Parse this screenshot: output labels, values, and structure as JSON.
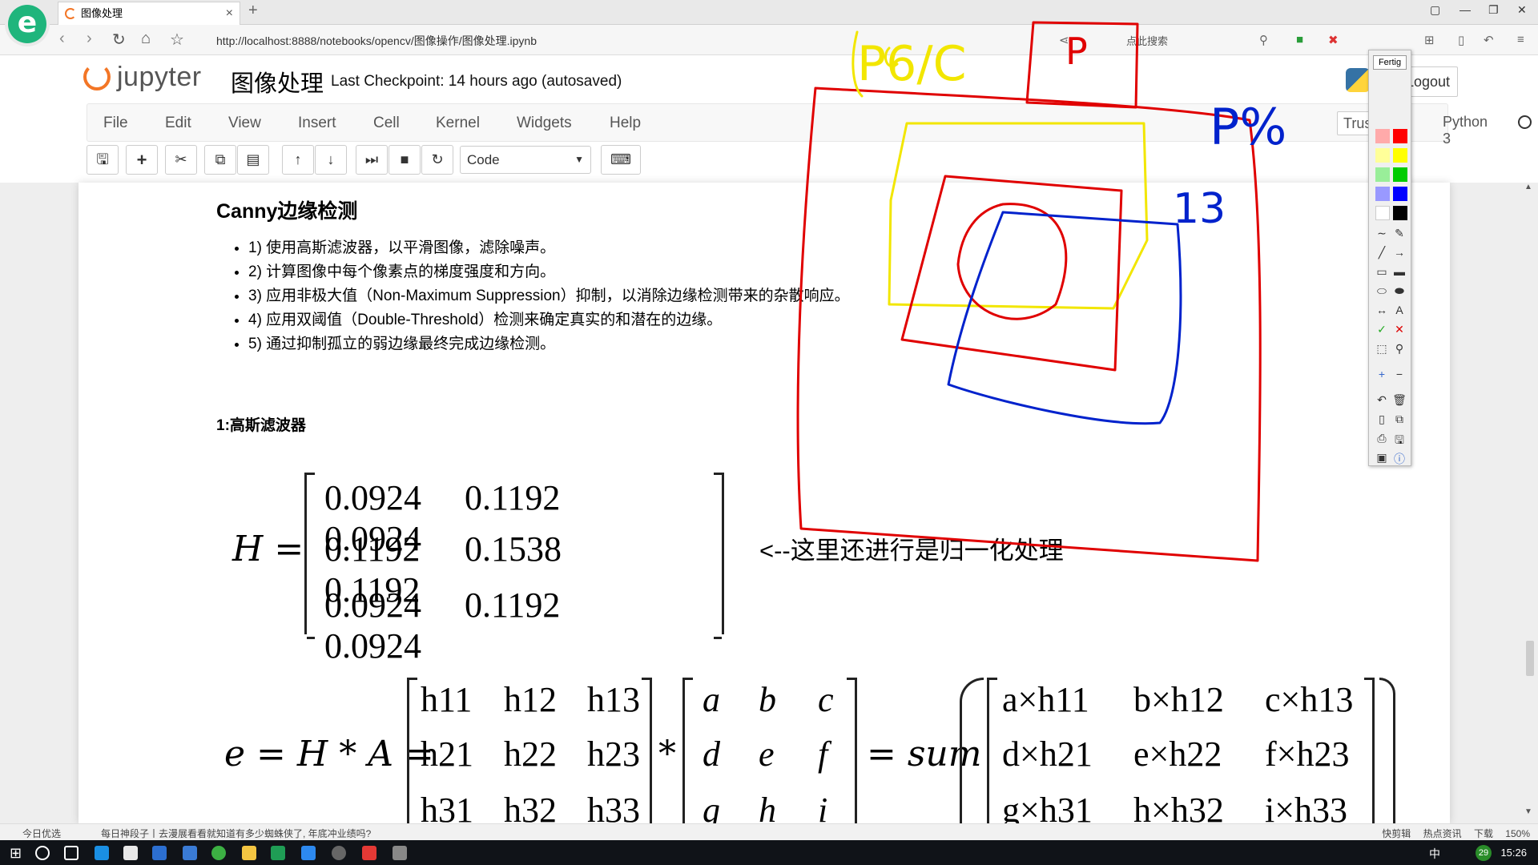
{
  "browser": {
    "tab_title": "图像处理",
    "tab_close": "×",
    "new_tab": "+",
    "url": "http://localhost:8888/notebooks/opencv/图像操作/图像处理.ipynb",
    "search_placeholder": "点此搜索",
    "win_controls": [
      "▢",
      "—",
      "❐",
      "✕"
    ]
  },
  "jupyter": {
    "logo_text": "jupyter",
    "notebook_title": "图像处理",
    "checkpoint": "Last Checkpoint: 14 hours ago (autosaved)",
    "logout": "Logout",
    "menu": [
      "File",
      "Edit",
      "View",
      "Insert",
      "Cell",
      "Kernel",
      "Widgets",
      "Help"
    ],
    "trusted": "Trusted",
    "kernel": "Python 3",
    "cell_type": "Code",
    "toolbar_icons": [
      "save-icon",
      "plus-icon",
      "cut-icon",
      "copy-icon",
      "paste-icon",
      "arrow-up-icon",
      "arrow-down-icon",
      "step-forward-icon",
      "stop-icon",
      "restart-icon",
      "keyboard-icon"
    ]
  },
  "notebook": {
    "heading": "Canny边缘检测",
    "steps": [
      "1) 使用高斯滤波器，以平滑图像，滤除噪声。",
      "2) 计算图像中每个像素点的梯度强度和方向。",
      "3) 应用非极大值（Non-Maximum Suppression）抑制，以消除边缘检测带来的杂散响应。",
      "4) 应用双阈值（Double-Threshold）检测来确定真实的和潜在的边缘。",
      "5) 通过抑制孤立的弱边缘最终完成边缘检测。"
    ],
    "subheading": "1:高斯滤波器",
    "H_label": "H =",
    "H_rows": [
      [
        "0.0924",
        "0.1192",
        "0.0924"
      ],
      [
        "0.1192",
        "0.1538",
        "0.1192"
      ],
      [
        "0.0924",
        "0.1192",
        "0.0924"
      ]
    ],
    "norm_note": "<--这里还进行是归一化处理",
    "conv_lhs": "e = H * A =",
    "star": "*",
    "sum_label": "= sum",
    "h_matrix": [
      [
        "h11",
        "h12",
        "h13"
      ],
      [
        "h21",
        "h22",
        "h23"
      ],
      [
        "h31",
        "h32",
        "h33"
      ]
    ],
    "a_matrix": [
      [
        "a",
        "b",
        "c"
      ],
      [
        "d",
        "e",
        "f"
      ],
      [
        "g",
        "h",
        "i"
      ]
    ],
    "prod_matrix": [
      [
        "a×h11",
        "b×h12",
        "c×h13"
      ],
      [
        "d×h21",
        "e×h22",
        "f×h23"
      ],
      [
        "g×h31",
        "h×h32",
        "i×h33"
      ]
    ]
  },
  "annotation_tool": {
    "label": "Fertig",
    "colors": [
      "#ff0000",
      "#ffff00",
      "#00cc00",
      "#0000ff",
      "#ffffff",
      "#000000"
    ]
  },
  "handwriting": {
    "top_left": "P6/C",
    "box_label": "P",
    "right_label": "P%",
    "number": "13"
  },
  "statusbar": {
    "hot": "今日优选",
    "news": "每日神段子丨去漫展看看就知道有多少蜘蛛侠了, 年底冲业绩吗?",
    "right": "快剪辑 热点资讯 下载 150%"
  },
  "taskbar": {
    "ime": "中",
    "badge": "29",
    "clock": "15:26"
  }
}
